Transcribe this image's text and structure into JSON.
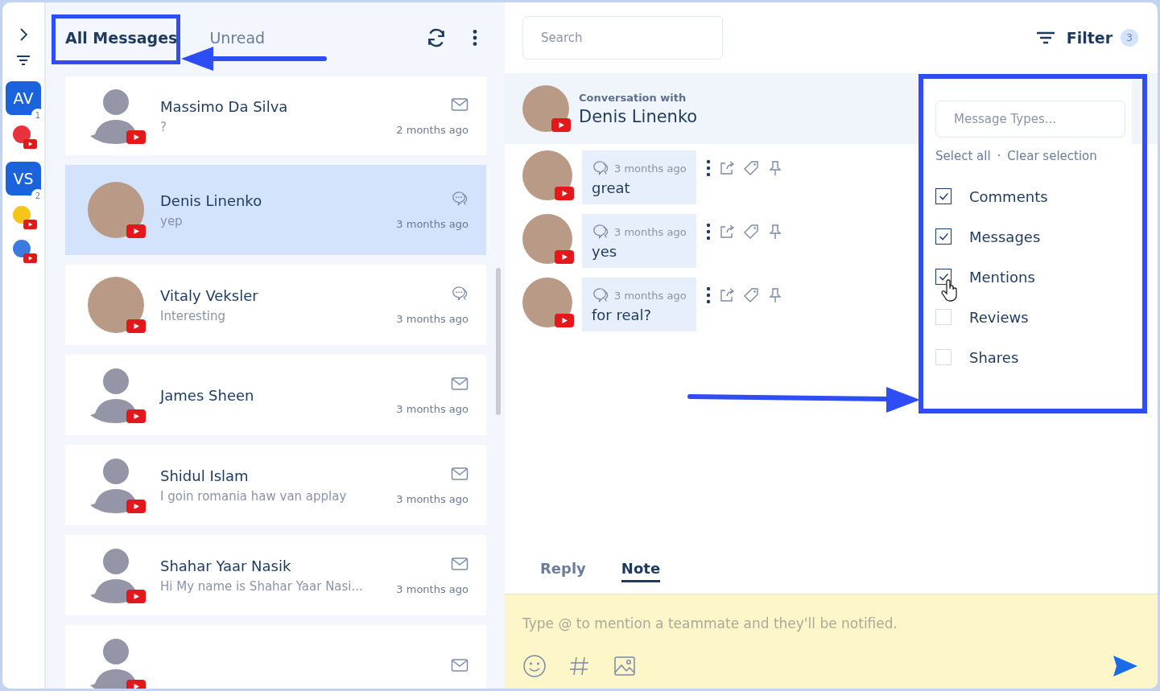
{
  "rail": {
    "accounts": [
      {
        "kind": "initials",
        "initials": "AV",
        "badge": "1"
      },
      {
        "kind": "logo",
        "color": "#e8323c"
      },
      {
        "kind": "initials",
        "initials": "VS",
        "badge": "2"
      },
      {
        "kind": "logo",
        "color": "#f5c518"
      },
      {
        "kind": "logo",
        "color": "#3b7be0"
      }
    ]
  },
  "tabs": [
    {
      "label": "All Messages",
      "selected": true
    },
    {
      "label": "Unread",
      "selected": false
    }
  ],
  "conversations": [
    {
      "name": "Massimo Da Silva",
      "preview": "?",
      "time": "2 months ago",
      "kind": "email",
      "photo": false,
      "selected": false
    },
    {
      "name": "Denis Linenko",
      "preview": "yep",
      "time": "3 months ago",
      "kind": "comment",
      "photo": true,
      "selected": true
    },
    {
      "name": "Vitaly Veksler",
      "preview": "Interesting",
      "time": "3 months ago",
      "kind": "comment",
      "photo": true,
      "selected": false
    },
    {
      "name": "James Sheen",
      "time": "3 months ago",
      "kind": "email",
      "photo": false,
      "selected": false
    },
    {
      "name": "Shidul Islam",
      "preview": "I goin romania haw van applay",
      "time": "3 months ago",
      "kind": "email",
      "photo": false,
      "selected": false
    },
    {
      "name": "Shahar Yaar Nasik",
      "preview": "Hi My name is Shahar Yaar Nasi...",
      "time": "3 months ago",
      "kind": "email",
      "photo": false,
      "selected": false
    },
    {
      "kind": "email",
      "photo": false,
      "selected": false
    }
  ],
  "search": {
    "placeholder": "Search"
  },
  "filter": {
    "label": "Filter",
    "count": "3"
  },
  "conversation": {
    "caption": "Conversation with",
    "name": "Denis Linenko",
    "messages": [
      {
        "time": "3 months ago",
        "text": "great"
      },
      {
        "time": "3 months ago",
        "text": "yes"
      },
      {
        "time": "3 months ago",
        "text": "for real?"
      }
    ]
  },
  "filter_menu": {
    "placeholder": "Message Types...",
    "select_all": "Select all",
    "separator": "·",
    "clear": "Clear selection",
    "options": [
      {
        "label": "Comments",
        "checked": true
      },
      {
        "label": "Messages",
        "checked": true
      },
      {
        "label": "Mentions",
        "checked": true
      },
      {
        "label": "Reviews",
        "checked": false
      },
      {
        "label": "Shares",
        "checked": false
      }
    ]
  },
  "composer": {
    "tabs": [
      {
        "label": "Reply",
        "selected": false
      },
      {
        "label": "Note",
        "selected": true
      }
    ],
    "placeholder": "Type @ to mention a teammate and they'll be notified."
  }
}
